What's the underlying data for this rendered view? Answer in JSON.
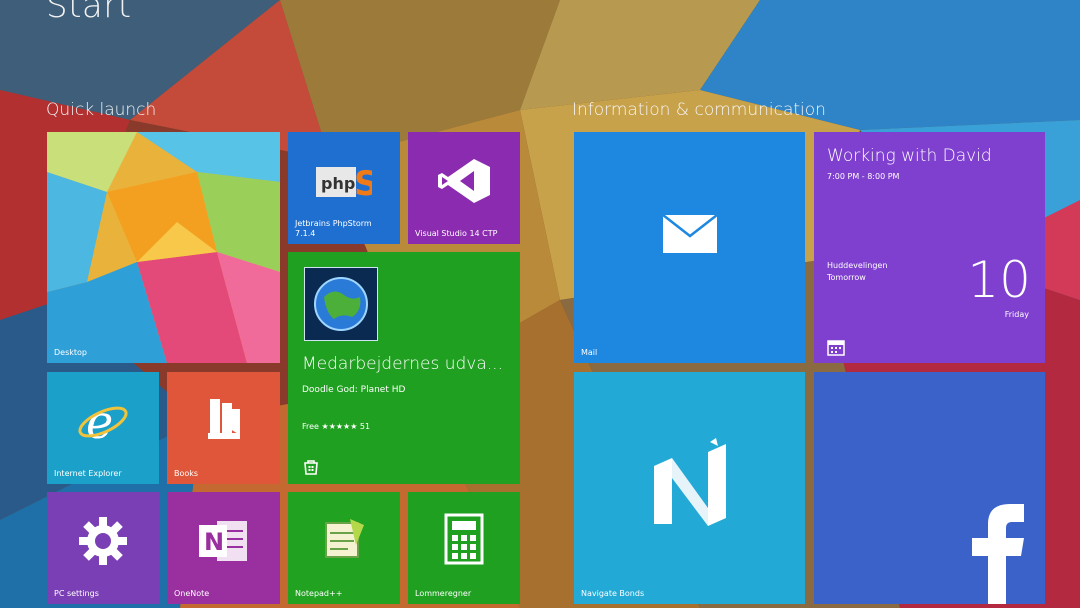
{
  "screen": {
    "title": "Start"
  },
  "groups": {
    "quick_launch": "Quick launch",
    "info_comm": "Information & communication"
  },
  "tiles": {
    "photo": {
      "label": "Desktop",
      "icon": "photo-mosaic"
    },
    "php": {
      "label_line1": "Jetbrains PhpStorm",
      "label_line2": "7.1.4",
      "icon": "phpstorm-icon",
      "color": "#1f6fd1"
    },
    "vs": {
      "label": "Visual Studio 14 CTP",
      "icon": "visual-studio-icon",
      "color": "#8a2bb0"
    },
    "store_app": {
      "title": "Medarbejdernes udva...",
      "subtitle": "Doodle God: Planet HD",
      "rating": "Free ★★★★★ 51",
      "icon": "globe-app-icon",
      "color": "#20a020"
    },
    "ie": {
      "label": "Internet Explorer",
      "icon": "internet-explorer-icon",
      "color": "#1ba1c9"
    },
    "books": {
      "label": "Books",
      "icon": "books-icon",
      "color": "#e0563a"
    },
    "pc_settings": {
      "label": "PC settings",
      "icon": "gear-icon",
      "color": "#7b3fb5"
    },
    "onenote": {
      "label": "OneNote",
      "icon": "onenote-icon",
      "color": "#9a2fa0"
    },
    "notepad": {
      "label": "Notepad++",
      "icon": "notepad-icon",
      "color": "#21a221"
    },
    "calculator": {
      "label": "Lommeregner",
      "icon": "calculator-icon",
      "color": "#1fa020"
    },
    "mail": {
      "label": "Mail",
      "icon": "mail-icon",
      "color": "#1e88e0"
    },
    "calendar": {
      "event_title": "Working with David",
      "event_time": "7:00 PM - 8:00 PM",
      "location_line1": "Huddevelingen",
      "location_line2": "Tomorrow",
      "day_number": "10",
      "day_name": "Friday",
      "icon": "calendar-icon",
      "color": "#7f3fcf"
    },
    "news": {
      "label": "Navigate Bonds",
      "icon": "n-logo-icon",
      "color": "#22a9d6"
    },
    "facebook": {
      "label": "",
      "icon": "facebook-icon",
      "color": "#3b62c8"
    }
  }
}
